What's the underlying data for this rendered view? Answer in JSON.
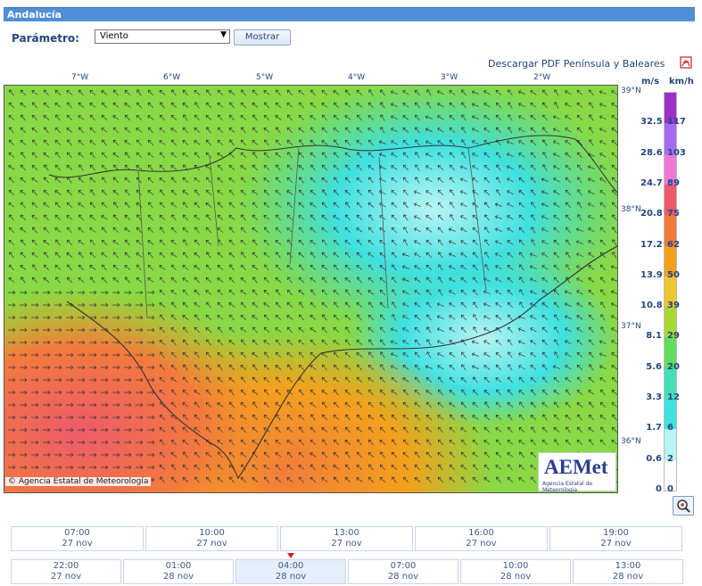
{
  "header": {
    "title": "Andalucía"
  },
  "controls": {
    "param_label": "Parámetro:",
    "param_value": "Viento",
    "show_button": "Mostrar",
    "pdf_link": "Descargar PDF Península y Baleares"
  },
  "map": {
    "lon_labels": [
      "7°W",
      "6°W",
      "5°W",
      "4°W",
      "3°W",
      "2°W"
    ],
    "lat_labels": [
      "39°N",
      "38°N",
      "37°N",
      "36°N"
    ],
    "copyright": "© Agencia Estatal de Meteorología",
    "logo_word": "AEMet",
    "logo_sub": "Agencia Estatal de Meteorología"
  },
  "legend": {
    "unit_ms": "m/s",
    "unit_kmh": "km/h",
    "ms": [
      "32.5",
      "28.6",
      "24.7",
      "20.8",
      "17.2",
      "13.9",
      "10.8",
      "8.1",
      "5.6",
      "3.3",
      "1.7",
      "0.6",
      "0"
    ],
    "kmh": [
      "117",
      "103",
      "89",
      "75",
      "62",
      "50",
      "39",
      "29",
      "20",
      "12",
      "6",
      "2",
      "0"
    ],
    "colors": [
      "#9b2fc9",
      "#a46cf0",
      "#ef77d8",
      "#ee5a6a",
      "#f27b3c",
      "#f3a11d",
      "#f0c52f",
      "#a8d832",
      "#62dc5e",
      "#45dfb6",
      "#3fe0e0",
      "#b9f4f4",
      "#ffffff"
    ]
  },
  "timeline": {
    "row1": [
      {
        "time": "07:00",
        "date": "27 nov"
      },
      {
        "time": "10:00",
        "date": "27 nov"
      },
      {
        "time": "13:00",
        "date": "27 nov"
      },
      {
        "time": "16:00",
        "date": "27 nov"
      },
      {
        "time": "19:00",
        "date": "27 nov"
      }
    ],
    "row2": [
      {
        "time": "22:00",
        "date": "27 nov"
      },
      {
        "time": "01:00",
        "date": "28 nov"
      },
      {
        "time": "04:00",
        "date": "28 nov"
      },
      {
        "time": "07:00",
        "date": "28 nov"
      },
      {
        "time": "10:00",
        "date": "28 nov"
      },
      {
        "time": "13:00",
        "date": "28 nov"
      }
    ],
    "active": "04:00 28 nov"
  }
}
